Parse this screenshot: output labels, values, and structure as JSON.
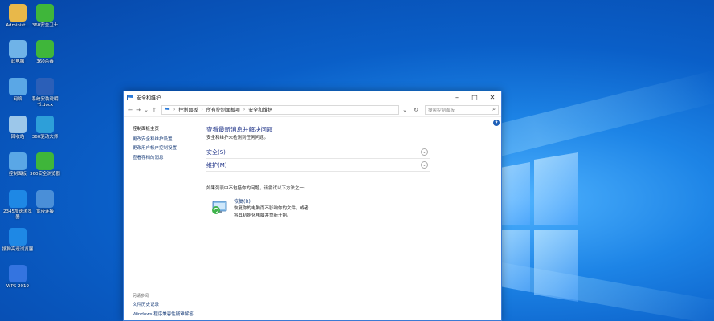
{
  "desktop": {
    "icons": [
      {
        "label": "Administ...",
        "icon": "user-folder-icon",
        "color": "#e8b84a"
      },
      {
        "label": "360安全卫士",
        "icon": "360-safe-icon",
        "color": "#3fb63a"
      },
      {
        "label": "此电脑",
        "icon": "computer-icon",
        "color": "#6fb3e8"
      },
      {
        "label": "360杀毒",
        "icon": "360-antivirus-icon",
        "color": "#3fb63a"
      },
      {
        "label": "网络",
        "icon": "network-icon",
        "color": "#5aa7e6"
      },
      {
        "label": "系统安装说明书.docx",
        "icon": "word-document-icon",
        "color": "#2b5fb8"
      },
      {
        "label": "回收站",
        "icon": "recycle-bin-icon",
        "color": "#9cc7ea"
      },
      {
        "label": "360驱动大师",
        "icon": "driver-master-icon",
        "color": "#2d9fd9"
      },
      {
        "label": "控制面板",
        "icon": "control-panel-icon",
        "color": "#5aa7e6"
      },
      {
        "label": "360安全浏览器",
        "icon": "360-browser-icon",
        "color": "#3fb63a"
      },
      {
        "label": "2345加速浏览器",
        "icon": "2345-browser-icon",
        "color": "#1e88e5"
      },
      {
        "label": "宽带连接",
        "icon": "broadband-icon",
        "color": "#4a8fd8"
      },
      {
        "label": "搜狗高速浏览器",
        "icon": "sogou-browser-icon",
        "color": "#1e88e5"
      },
      {
        "label": "WPS 2019",
        "icon": "wps-icon",
        "color": "#3474e0"
      }
    ]
  },
  "window": {
    "title": "安全和维护",
    "address": {
      "crumbs": [
        "控制面板",
        "所有控制面板项",
        "安全和维护"
      ]
    },
    "search_placeholder": "搜索控制面板",
    "sidebar": {
      "home": "控制面板主页",
      "links": [
        "更改安全和维护设置",
        "更改用户帐户控制设置",
        "查看存档的消息"
      ],
      "see_also_title": "另请参阅",
      "see_also": [
        "文件历史记录",
        "Windows 程序兼容性疑难解答"
      ]
    },
    "main": {
      "heading": "查看最新消息并解决问题",
      "subtitle": "安全和维护未检测到任何问题。",
      "sections": [
        {
          "label": "安全(S)"
        },
        {
          "label": "维护(M)"
        }
      ],
      "hint": "如果列表中不包括你的问题，请尝试以下方法之一:",
      "recovery": {
        "link": "恢复(R)",
        "description": "恢复你的电脑而不影响你的文件，或者将其初始化电脑并重新开始。"
      }
    }
  }
}
